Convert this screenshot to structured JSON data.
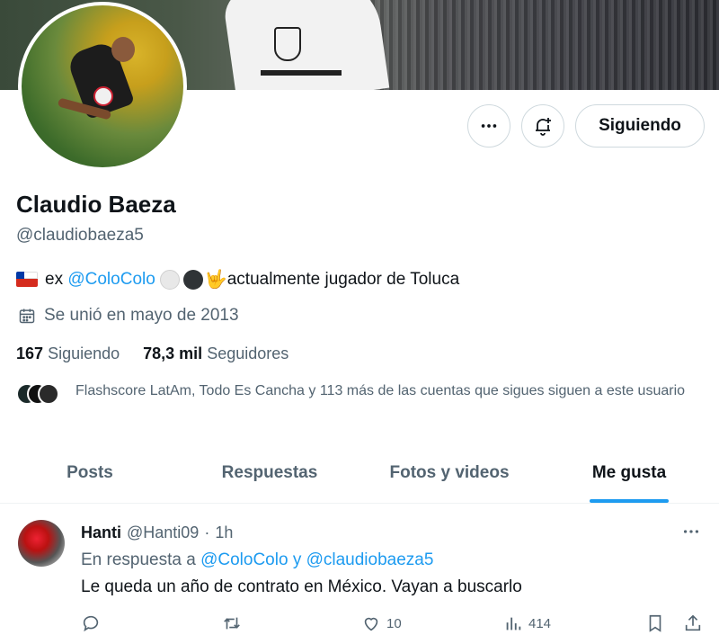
{
  "header": {
    "following_button": "Siguiendo"
  },
  "profile": {
    "name": "Claudio Baeza",
    "handle": "@claudiobaeza5",
    "bio_prefix": "ex",
    "bio_mention": "@ColoColo",
    "bio_suffix": "actualmente jugador de Toluca",
    "joined": "Se unió en mayo de 2013",
    "following_count": "167",
    "following_label": "Siguiendo",
    "followers_count": "78,3 mil",
    "followers_label": "Seguidores",
    "known_followers": "Flashscore LatAm, Todo Es Cancha y 113 más de las cuentas que sigues siguen a este usuario"
  },
  "tabs": [
    {
      "label": "Posts"
    },
    {
      "label": "Respuestas"
    },
    {
      "label": "Fotos y videos"
    },
    {
      "label": "Me gusta"
    }
  ],
  "tweet": {
    "name": "Hanti",
    "handle": "@Hanti09",
    "separator": "·",
    "time": "1h",
    "reply_prefix": "En respuesta a",
    "reply_mentions": "@ColoColo y @claudiobaeza5",
    "text": "Le queda un año de contrato en México. Vayan a buscarlo",
    "likes": "10",
    "views": "414"
  },
  "colors": {
    "accent": "#1d9bf0",
    "text": "#0f1419",
    "muted": "#536471"
  }
}
